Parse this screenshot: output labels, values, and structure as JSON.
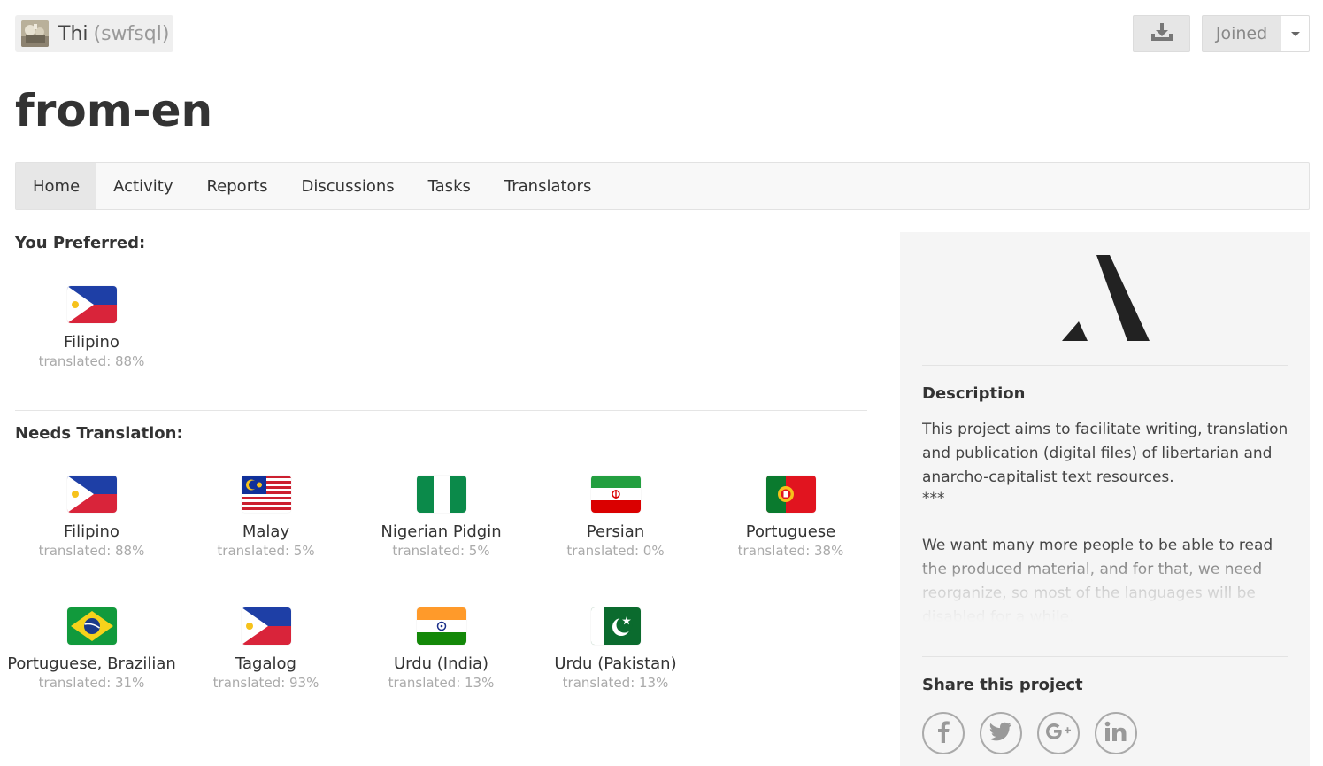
{
  "owner": {
    "name": "Thi",
    "handle": "(swfsql)"
  },
  "actions": {
    "joined_label": "Joined"
  },
  "project": {
    "title": "from-en"
  },
  "nav": {
    "items": [
      {
        "label": "Home"
      },
      {
        "label": "Activity"
      },
      {
        "label": "Reports"
      },
      {
        "label": "Discussions"
      },
      {
        "label": "Tasks"
      },
      {
        "label": "Translators"
      }
    ]
  },
  "preferred": {
    "heading": "You Preferred:",
    "languages": [
      {
        "name": "Filipino",
        "progress": "translated: 88%",
        "flag": "ph"
      }
    ]
  },
  "needs": {
    "heading": "Needs Translation:",
    "languages": [
      {
        "name": "Filipino",
        "progress": "translated: 88%",
        "flag": "ph"
      },
      {
        "name": "Malay",
        "progress": "translated: 5%",
        "flag": "my"
      },
      {
        "name": "Nigerian Pidgin",
        "progress": "translated: 5%",
        "flag": "ng"
      },
      {
        "name": "Persian",
        "progress": "translated: 0%",
        "flag": "ir"
      },
      {
        "name": "Portuguese",
        "progress": "translated: 38%",
        "flag": "pt"
      },
      {
        "name": "Portuguese, Brazilian",
        "progress": "translated: 31%",
        "flag": "br"
      },
      {
        "name": "Tagalog",
        "progress": "translated: 93%",
        "flag": "ph"
      },
      {
        "name": "Urdu (India)",
        "progress": "translated: 13%",
        "flag": "in"
      },
      {
        "name": "Urdu (Pakistan)",
        "progress": "translated: 13%",
        "flag": "pk"
      }
    ]
  },
  "sidebar": {
    "description_heading": "Description",
    "description_p1": "This project aims to facilitate writing, translation and publication (digital files) of libertarian and anarcho-capitalist text resources.",
    "description_stars": "***",
    "description_p2": "We want many more people to be able to read the produced material, and for that, we need reorganize, so most of the languages will be disabled for a while.",
    "share_heading": "Share this project",
    "share_icons": [
      "facebook-icon",
      "twitter-icon",
      "google-plus-icon",
      "linkedin-icon"
    ]
  },
  "colors": {
    "accent_dark": "#222222",
    "muted_text": "#aaaaaa"
  }
}
